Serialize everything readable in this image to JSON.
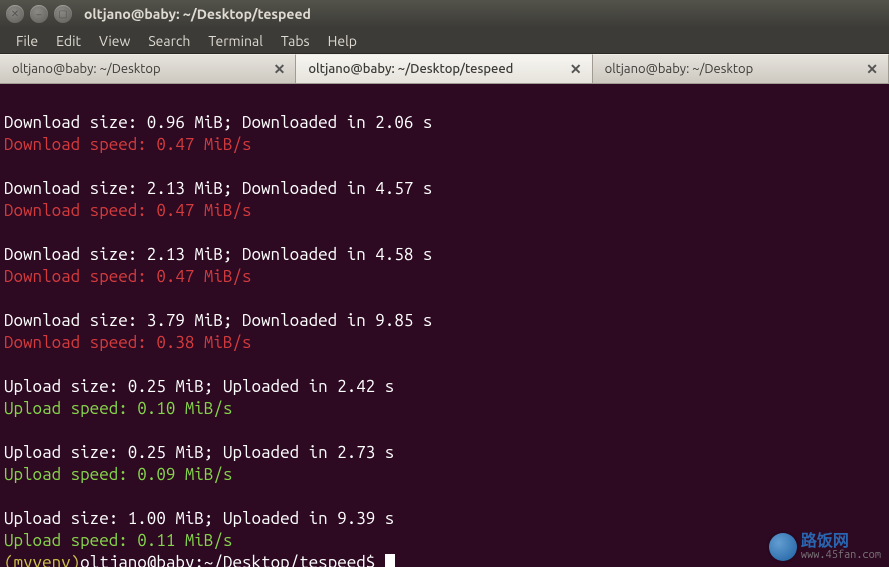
{
  "window": {
    "title": "oltjano@baby: ~/Desktop/tespeed"
  },
  "menu": {
    "items": [
      "File",
      "Edit",
      "View",
      "Search",
      "Terminal",
      "Tabs",
      "Help"
    ]
  },
  "tabs": [
    {
      "label": "oltjano@baby: ~/Desktop",
      "active": false
    },
    {
      "label": "oltjano@baby: ~/Desktop/tespeed",
      "active": true
    },
    {
      "label": "oltjano@baby: ~/Desktop",
      "active": false
    }
  ],
  "output": [
    {
      "type": "blank"
    },
    {
      "type": "info",
      "text": "Download size: 0.96 MiB; Downloaded in 2.06 s"
    },
    {
      "type": "download",
      "text": "Download speed: 0.47 MiB/s"
    },
    {
      "type": "blank"
    },
    {
      "type": "info",
      "text": "Download size: 2.13 MiB; Downloaded in 4.57 s"
    },
    {
      "type": "download",
      "text": "Download speed: 0.47 MiB/s"
    },
    {
      "type": "blank"
    },
    {
      "type": "info",
      "text": "Download size: 2.13 MiB; Downloaded in 4.58 s"
    },
    {
      "type": "download",
      "text": "Download speed: 0.47 MiB/s"
    },
    {
      "type": "blank"
    },
    {
      "type": "info",
      "text": "Download size: 3.79 MiB; Downloaded in 9.85 s"
    },
    {
      "type": "download",
      "text": "Download speed: 0.38 MiB/s"
    },
    {
      "type": "blank"
    },
    {
      "type": "info",
      "text": "Upload size: 0.25 MiB; Uploaded in 2.42 s"
    },
    {
      "type": "upload",
      "text": "Upload speed: 0.10 MiB/s"
    },
    {
      "type": "blank"
    },
    {
      "type": "info",
      "text": "Upload size: 0.25 MiB; Uploaded in 2.73 s"
    },
    {
      "type": "upload",
      "text": "Upload speed: 0.09 MiB/s"
    },
    {
      "type": "blank"
    },
    {
      "type": "info",
      "text": "Upload size: 1.00 MiB; Uploaded in 9.39 s"
    },
    {
      "type": "upload",
      "text": "Upload speed: 0.11 MiB/s"
    }
  ],
  "prompt": {
    "prefix": "(myvenv)",
    "userhost": "oltjano@baby",
    "path": "~/Desktop/tespeed",
    "symbol": "$"
  },
  "watermark": {
    "cn": "路饭网",
    "domain": "www.45fan.com"
  }
}
